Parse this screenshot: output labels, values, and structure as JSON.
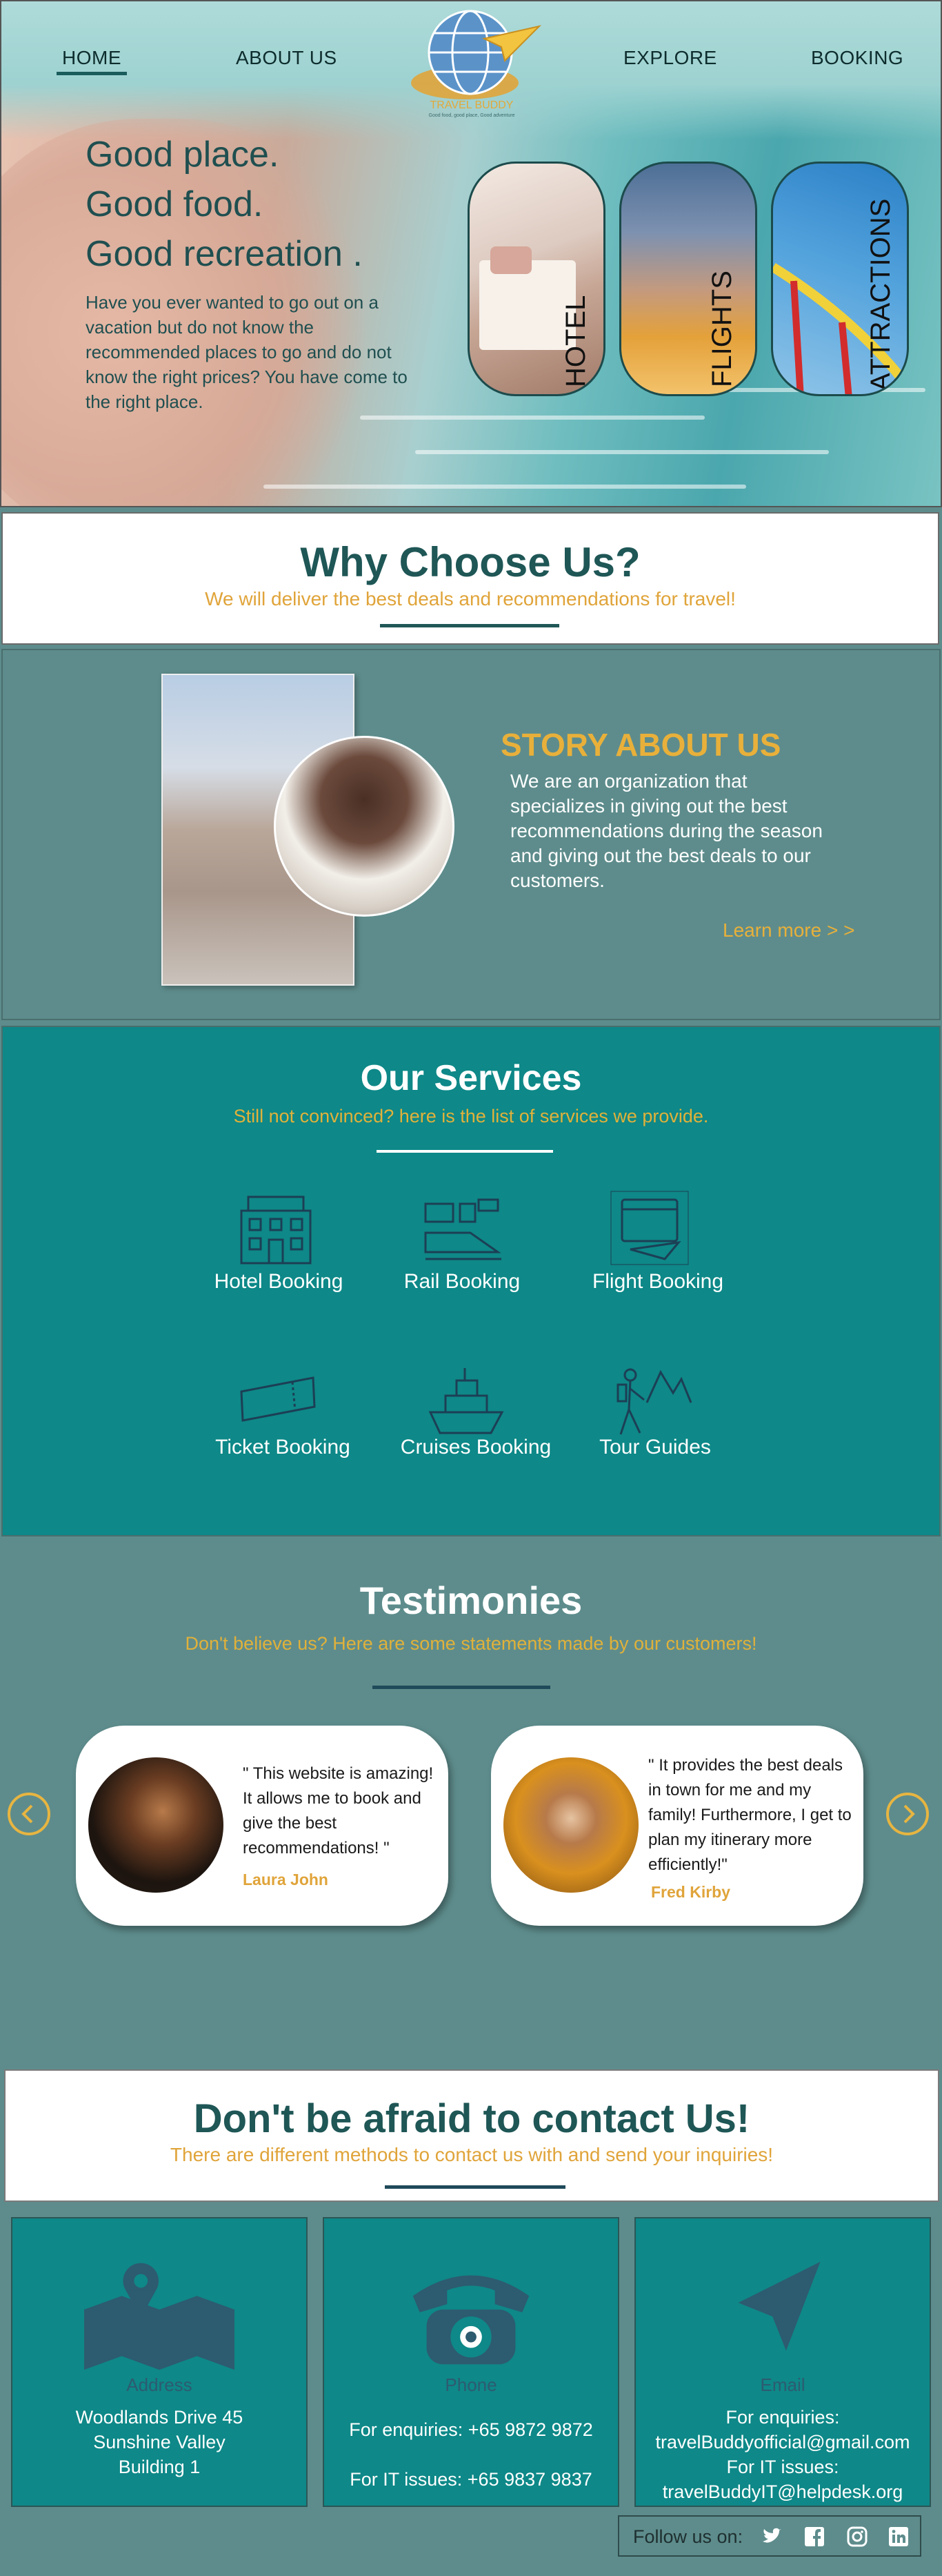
{
  "nav": {
    "home": "HOME",
    "about": "ABOUT US",
    "explore": "EXPLORE",
    "booking": "BOOKING",
    "logo_text": "TRAVEL BUDDY",
    "logo_tagline": "Good food, good place, Good adventure"
  },
  "hero": {
    "line1": "Good place.",
    "line2": "Good food.",
    "line3": "Good recreation .",
    "paragraph": "Have you ever wanted to go out on a vacation but do not know the recommended places to go and do not know the right prices? You have come to the right place.",
    "cards": [
      "HOTEL",
      "FLIGHTS",
      "ATTRACTIONS"
    ]
  },
  "why": {
    "title": "Why Choose Us?",
    "subtitle": "We will deliver the best deals and recommendations for travel!"
  },
  "story": {
    "title": "STORY ABOUT US",
    "paragraph": "We are an organization that specializes in giving out the best recommendations during the season and giving out the best deals to our customers.",
    "link": "Learn more > >"
  },
  "services": {
    "title": "Our Services",
    "subtitle": "Still not convinced? here is the list of services we provide.",
    "items": [
      {
        "label": "Hotel Booking",
        "icon": "hotel-icon"
      },
      {
        "label": "Rail Booking",
        "icon": "train-icon"
      },
      {
        "label": "Flight Booking",
        "icon": "flight-calendar-icon"
      },
      {
        "label": "Ticket Booking",
        "icon": "ticket-icon"
      },
      {
        "label": "Cruises Booking",
        "icon": "ship-icon"
      },
      {
        "label": "Tour Guides",
        "icon": "hiker-icon"
      }
    ]
  },
  "testimonies": {
    "title": "Testimonies",
    "subtitle": "Don't believe us? Here are some statements made by our customers!",
    "cards": [
      {
        "quote": "\" This website is amazing! It allows me to book and give the best recommendations! \"",
        "name": "Laura John"
      },
      {
        "quote": "\" It provides the best deals in town for me and my family! Furthermore, I get to plan my itinerary more efficiently!\"",
        "name": "Fred Kirby"
      }
    ]
  },
  "contact": {
    "title": "Don't be afraid to contact Us!",
    "subtitle": "There are different methods to contact us with and send your inquiries!",
    "address": {
      "label": "Address",
      "lines": [
        "Woodlands Drive 45",
        "Sunshine Valley",
        "Building 1"
      ]
    },
    "phone": {
      "label": "Phone",
      "enquiries": "For enquiries: +65 9872 9872",
      "it": "For IT issues: +65 9837 9837"
    },
    "email": {
      "label": "Email",
      "lines": [
        "For enquiries:",
        "travelBuddyofficial@gmail.com",
        "For IT issues:",
        "travelBuddyIT@helpdesk.org"
      ]
    }
  },
  "follow": {
    "label": "Follow us on:"
  },
  "colors": {
    "accent": "#e0a43a",
    "teal": "#0e8888",
    "slate": "#5e8c8c",
    "dark": "#1f5656"
  }
}
